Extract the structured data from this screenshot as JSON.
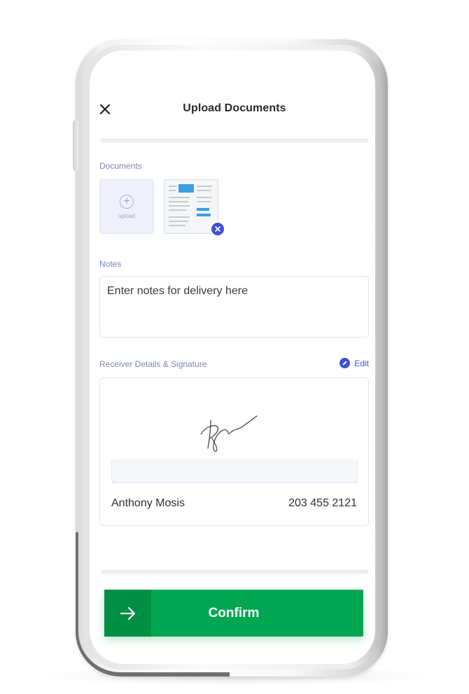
{
  "header": {
    "title": "Upload Documents",
    "close_icon": "close-icon"
  },
  "documents": {
    "label": "Documents",
    "upload_label": "upload",
    "upload_icon": "plus-circle-icon",
    "remove_icon": "close-icon"
  },
  "notes": {
    "label": "Notes",
    "placeholder": "Enter notes for delivery here"
  },
  "receiver": {
    "label": "Receiver Details & Signature",
    "edit_label": "Edit",
    "edit_icon": "pencil-icon",
    "name": "Anthony Mosis",
    "phone": "203 455 2121"
  },
  "actions": {
    "confirm_label": "Confirm",
    "confirm_icon": "arrow-right-icon"
  },
  "colors": {
    "accent": "#3f4fd3",
    "primary_green": "#00a651",
    "primary_green_dark": "#008f45",
    "label_color": "#7a84b8"
  }
}
